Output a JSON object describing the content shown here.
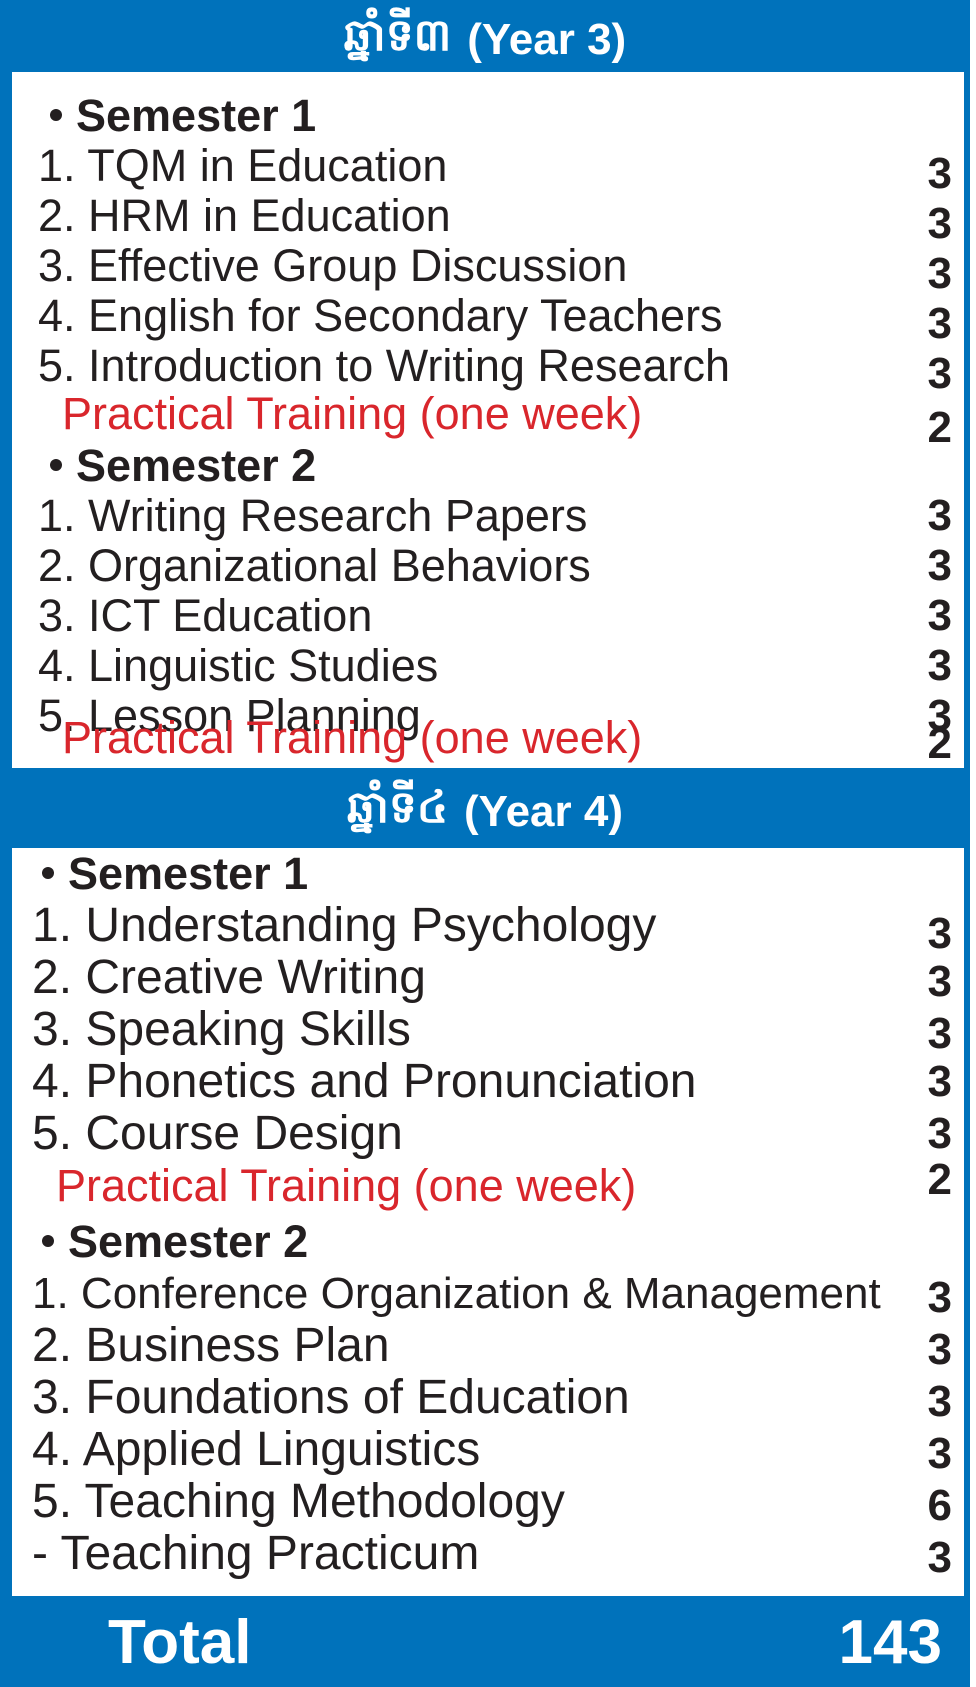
{
  "year3": {
    "title_kh": "ឆ្នាំទី៣",
    "title_en": "(Year 3)",
    "sem1": {
      "title": "Semester 1",
      "courses": [
        {
          "name": "1. TQM in Education",
          "credits": "3"
        },
        {
          "name": "2. HRM in Education",
          "credits": "3"
        },
        {
          "name": "3. Effective Group Discussion",
          "credits": "3"
        },
        {
          "name": "4. English for Secondary Teachers",
          "credits": "3"
        },
        {
          "name": "5. Introduction to Writing Research",
          "credits": "3"
        }
      ],
      "practical": {
        "name": "Practical Training (one week)",
        "credits": "2"
      }
    },
    "sem2": {
      "title": "Semester 2",
      "courses": [
        {
          "name": "1. Writing Research Papers",
          "credits": "3"
        },
        {
          "name": "2. Organizational Behaviors",
          "credits": "3"
        },
        {
          "name": "3. ICT Education",
          "credits": "3"
        },
        {
          "name": "4. Linguistic Studies",
          "credits": "3"
        },
        {
          "name": "5. Lesson Planning",
          "credits": "3"
        }
      ],
      "practical": {
        "name": "Practical Training (one week)",
        "credits": "2"
      }
    }
  },
  "year4": {
    "title_kh": "ឆ្នាំទី៤",
    "title_en": "(Year 4)",
    "sem1": {
      "title": "Semester 1",
      "courses": [
        {
          "name": "1. Understanding Psychology",
          "credits": "3"
        },
        {
          "name": "2. Creative Writing",
          "credits": "3"
        },
        {
          "name": "3. Speaking Skills",
          "credits": "3"
        },
        {
          "name": "4. Phonetics and Pronunciation",
          "credits": "3"
        },
        {
          "name": "5. Course Design",
          "credits": "3"
        }
      ],
      "practical": {
        "name": "Practical Training (one week)",
        "credits": "2"
      }
    },
    "sem2": {
      "title": "Semester 2",
      "courses": [
        {
          "name": "1. Conference Organization & Management",
          "credits": "3"
        },
        {
          "name": "2. Business Plan",
          "credits": "3"
        },
        {
          "name": "3. Foundations of Education",
          "credits": "3"
        },
        {
          "name": "4. Applied Linguistics",
          "credits": "3"
        },
        {
          "name": "5. Teaching Methodology",
          "credits": "6"
        },
        {
          "name": "- Teaching Practicum",
          "credits": "3"
        }
      ]
    }
  },
  "total": {
    "label": "Total",
    "value": "143"
  },
  "colors": {
    "header_blue": "#0072bb",
    "practical_red": "#d9262c",
    "text": "#231f20"
  }
}
